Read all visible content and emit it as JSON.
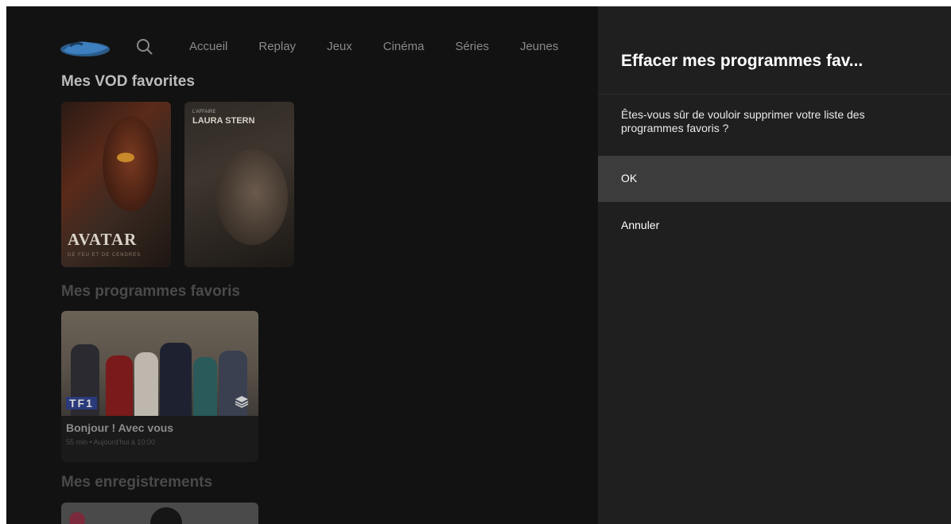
{
  "nav": {
    "items": [
      "Accueil",
      "Replay",
      "Jeux",
      "Cinéma",
      "Séries",
      "Jeunes"
    ]
  },
  "sections": {
    "vod": "Mes VOD favorites",
    "programs": "Mes programmes favoris",
    "recordings": "Mes enregistrements"
  },
  "posters": [
    {
      "title": "AVATAR",
      "subtitle": "DE FEU ET DE CENDRES"
    },
    {
      "kicker": "L'AFFAIRE",
      "title": "LAURA STERN"
    }
  ],
  "program_card": {
    "channel": "TF1",
    "title": "Bonjour ! Avec vous",
    "meta": "55 min • Aujourd'hui à 10:00"
  },
  "dialog": {
    "title": "Effacer mes programmes fav...",
    "message": "Êtes-vous sûr de vouloir supprimer votre liste des programmes favoris ?",
    "options": [
      "OK",
      "Annuler"
    ]
  },
  "colors": {
    "background": "#121212",
    "panel": "#1f1f1f",
    "selected_option": "#3c3c3c"
  }
}
